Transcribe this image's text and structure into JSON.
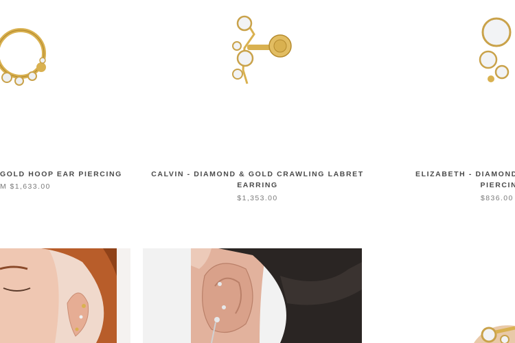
{
  "products": [
    {
      "title": "GOLD HOOP EAR PIERCING",
      "price_prefix": "M",
      "price": "$1,633.00"
    },
    {
      "title_line1": "CALVIN - DIAMOND & GOLD CRAWLING LABRET",
      "title_line2": "EARRING",
      "price": "$1,353.00"
    },
    {
      "title_line1": "ELIZABETH - DIAMOND &",
      "title_line2": "PIERCING",
      "price": "$836.00"
    }
  ],
  "lifestyle_images": [
    {
      "alt": "model-ear-with-piercings-1"
    },
    {
      "alt": "model-ear-with-piercings-2"
    },
    {
      "alt": "gold-diamond-piercing-closeup"
    }
  ],
  "colors": {
    "gold": "#d9b150",
    "gold_dark": "#b58b2e",
    "diamond": "#eef0f2",
    "skin": "#e8b9a3",
    "hair": "#b85d2a"
  }
}
